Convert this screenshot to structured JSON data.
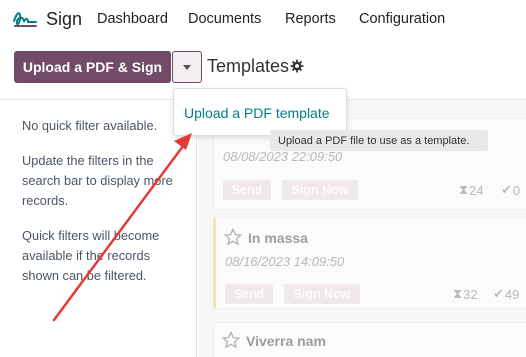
{
  "app": {
    "name": "Sign",
    "logo_icon": "sign-logo-icon"
  },
  "nav": {
    "items": [
      {
        "label": "Dashboard"
      },
      {
        "label": "Documents"
      },
      {
        "label": "Reports"
      },
      {
        "label": "Configuration"
      }
    ]
  },
  "control_panel": {
    "upload_button_label": "Upload a PDF & Sign",
    "breadcrumb_title": "Templates",
    "settings_icon": "gear-icon"
  },
  "dropdown": {
    "item_label": "Upload a PDF template",
    "tooltip": "Upload a PDF file to use as a template."
  },
  "sidebar": {
    "paragraphs": [
      "No quick filter available.",
      "Update the filters in the search bar to display more records.",
      "Quick filters will become available if the records shown can be filtered."
    ]
  },
  "cards": [
    {
      "title": "",
      "date": "08/08/2023 22:09:50",
      "send_label": "Send",
      "sign_now_label": "Sign Now",
      "pending_count": "24",
      "done_count": "0"
    },
    {
      "title": "In massa",
      "date": "08/16/2023 14:09:50",
      "send_label": "Send",
      "sign_now_label": "Sign Now",
      "pending_count": "32",
      "done_count": "49"
    },
    {
      "title": "Viverra nam"
    }
  ],
  "colors": {
    "primary": "#714b67",
    "link": "#017e84",
    "arrow": "#e53935"
  }
}
